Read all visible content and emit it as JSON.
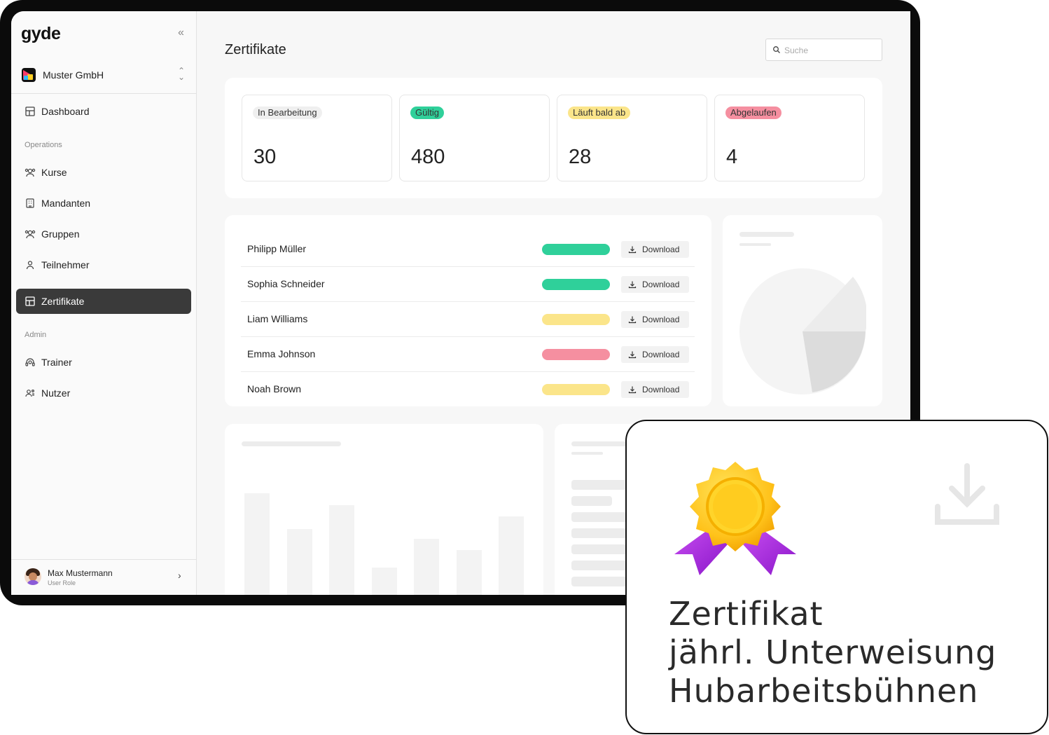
{
  "app": {
    "logo": "gyde",
    "collapse_icon": "chevrons-left-icon"
  },
  "org": {
    "name": "Muster GmbH"
  },
  "nav": {
    "dashboard": "Dashboard",
    "section_operations": "Operations",
    "kurse": "Kurse",
    "mandanten": "Mandanten",
    "gruppen": "Gruppen",
    "teilnehmer": "Teilnehmer",
    "zertifikate": "Zertifikate",
    "section_admin": "Admin",
    "trainer": "Trainer",
    "nutzer": "Nutzer"
  },
  "user": {
    "name": "Max Mustermann",
    "role": "User Role"
  },
  "page": {
    "title": "Zertifikate"
  },
  "search": {
    "placeholder": "Suche"
  },
  "stats": [
    {
      "label": "In Bearbeitung",
      "value": "30",
      "color": "#efefef"
    },
    {
      "label": "Gültig",
      "value": "480",
      "color": "#2fd09a"
    },
    {
      "label": "Läuft bald ab",
      "value": "28",
      "color": "#fbe58a"
    },
    {
      "label": "Abgelaufen",
      "value": "4",
      "color": "#f58fa0"
    }
  ],
  "certificates": [
    {
      "name": "Philipp Müller",
      "status_color": "#2fd09a",
      "action": "Download"
    },
    {
      "name": "Sophia Schneider",
      "status_color": "#2fd09a",
      "action": "Download"
    },
    {
      "name": "Liam Williams",
      "status_color": "#fbe58a",
      "action": "Download"
    },
    {
      "name": "Emma Johnson",
      "status_color": "#f58fa0",
      "action": "Download"
    },
    {
      "name": "Noah Brown",
      "status_color": "#fbe58a",
      "action": "Download"
    }
  ],
  "card": {
    "line1": "Zertifikat",
    "line2": "jährl. Unterweisung",
    "line3": "Hubarbeitsbühnen"
  }
}
